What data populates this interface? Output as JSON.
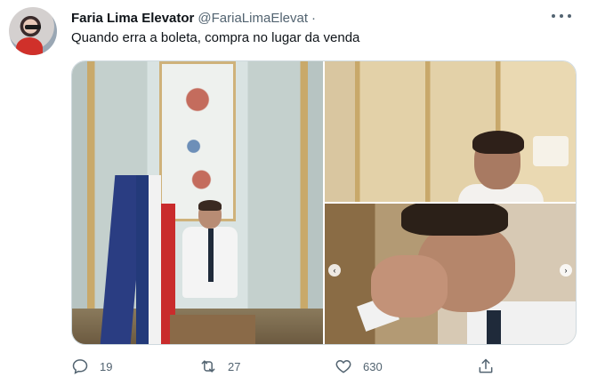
{
  "tweet": {
    "author_name": "Faria Lima Elevator",
    "author_handle": "@FariaLimaElevat",
    "separator": "·",
    "text": "Quando erra a boleta, compra no lugar da venda"
  },
  "actions": {
    "reply_count": "19",
    "retweet_count": "27",
    "like_count": "630"
  },
  "media": {
    "count": 3,
    "nav_prev": "‹",
    "nav_next": "›"
  },
  "colors": {
    "text_primary": "#0f1419",
    "text_secondary": "#536471",
    "border": "#cfd9de"
  }
}
